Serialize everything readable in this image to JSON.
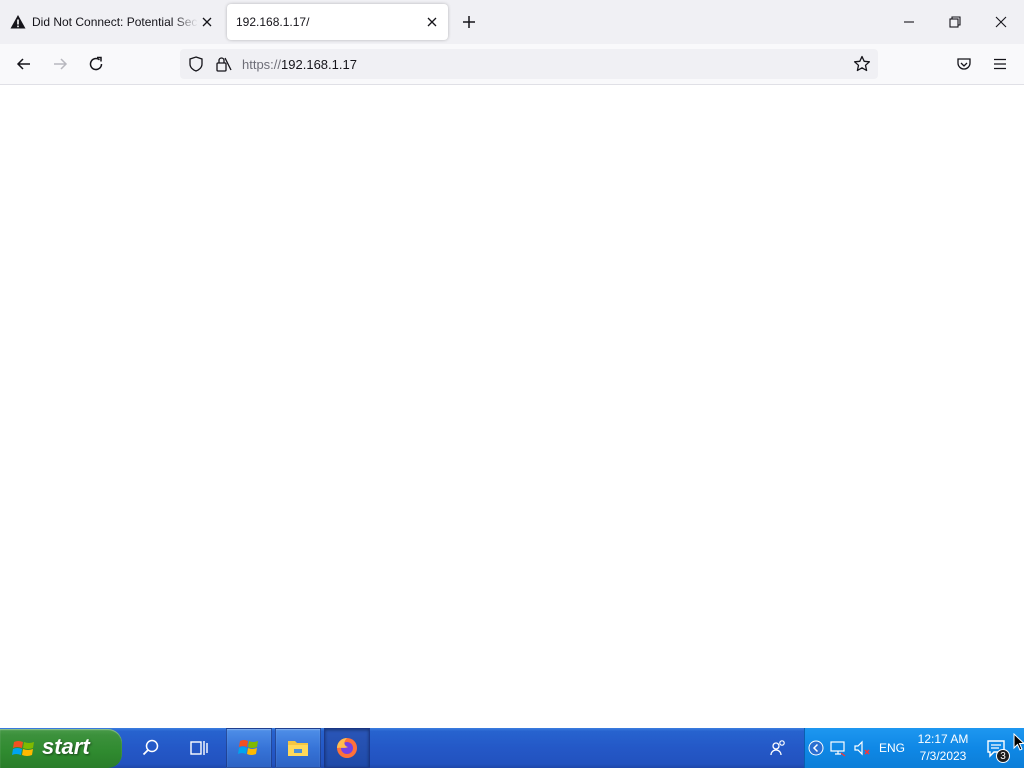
{
  "browser": {
    "tabs": [
      {
        "label": "Did Not Connect: Potential Security Issue",
        "icon": "warning-icon",
        "active": false
      },
      {
        "label": "192.168.1.17/",
        "active": true
      }
    ],
    "url": {
      "scheme": "https://",
      "host": "192.168.1.17"
    },
    "window_controls": [
      "minimize",
      "restore",
      "close"
    ],
    "toolbar_icons": [
      "back-icon",
      "forward-icon",
      "reload-icon",
      "pocket-icon",
      "menu-icon"
    ]
  },
  "taskbar": {
    "start_label": "start",
    "pinned": [
      "search-icon",
      "task-view-icon",
      "windows-flag-app-icon",
      "file-explorer-icon",
      "firefox-icon"
    ],
    "tray": {
      "language": "ENG",
      "time": "12:17 AM",
      "date": "7/3/2023",
      "notification_count": "3"
    }
  },
  "colors": {
    "taskbar_blue": "#2458c7",
    "start_green": "#2f8a2f",
    "tray_blue": "#0f88e6"
  }
}
